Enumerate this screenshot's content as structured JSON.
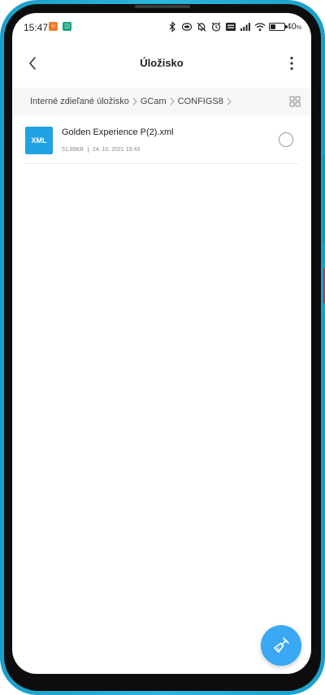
{
  "status_bar": {
    "time": "15:47",
    "battery_text": "40",
    "battery_unit": "%",
    "battery_level": 0.4,
    "icons": [
      "bluetooth-icon",
      "nfc-icon",
      "mute-icon",
      "alarm-icon",
      "volte-icon",
      "signal-icon",
      "wifi-icon",
      "battery-icon"
    ]
  },
  "app_bar": {
    "title": "Úložisko"
  },
  "breadcrumb": {
    "items": [
      "Interné zdieľané úložisko",
      "GCam",
      "CONFIGS8"
    ]
  },
  "files": [
    {
      "icon_label": "XML",
      "name": "Golden Experience P(2).xml",
      "size": "51,88KB",
      "date": "24. 10. 2021 15:43"
    }
  ],
  "colors": {
    "accent": "#3aa8f3",
    "xml_icon": "#21a2e2",
    "frame": "#2bb6df"
  }
}
